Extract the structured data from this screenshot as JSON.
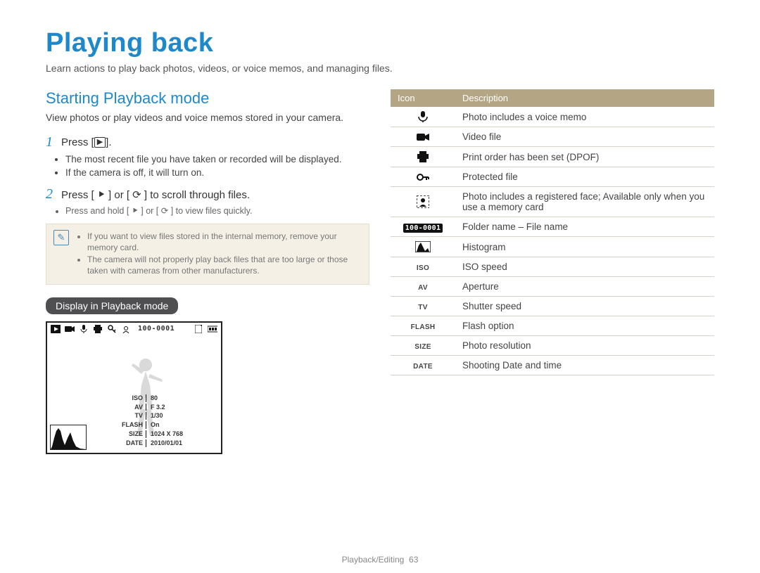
{
  "title": "Playing back",
  "subtitle": "Learn actions to play back photos, videos, or voice memos, and managing files.",
  "left": {
    "section_title": "Starting Playback mode",
    "section_desc": "View photos or play videos and voice memos stored in your camera.",
    "step1_num": "1",
    "step1_text_a": "Press [",
    "step1_text_b": "].",
    "step1_bullets": [
      "The most recent file you have taken or recorded will be displayed.",
      "If the camera is off, it will turn on."
    ],
    "step2_num": "2",
    "step2_text": "Press [ ⯈ ] or [ ⟳ ] to scroll through files.",
    "step2_bullets": [
      "Press and hold [ ⯈ ] or [ ⟳ ] to view files quickly."
    ],
    "note": [
      "If you want to view files stored in the internal memory, remove your memory card.",
      "The camera will not properly play back files that are too large or those taken with cameras from other manufacturers."
    ],
    "pill": "Display in Playback mode",
    "screen": {
      "folder_file": "100-0001",
      "info": {
        "ISO": "80",
        "AV": "F 3.2",
        "TV": "1/30",
        "FLASH": "On",
        "SIZE": "1024 X 768",
        "DATE": "2010/01/01"
      }
    }
  },
  "table": {
    "head_icon": "Icon",
    "head_desc": "Description",
    "rows": [
      {
        "icon_name": "mic-icon",
        "label": "",
        "desc": "Photo includes a voice memo"
      },
      {
        "icon_name": "video-icon",
        "label": "",
        "desc": "Video file"
      },
      {
        "icon_name": "printer-icon",
        "label": "",
        "desc": "Print order has been set (DPOF)"
      },
      {
        "icon_name": "key-icon",
        "label": "",
        "desc": "Protected file"
      },
      {
        "icon_name": "face-icon",
        "label": "",
        "desc": "Photo includes a registered face; Available only when you use a memory card"
      },
      {
        "icon_name": "folder-file",
        "label": "100-0001",
        "desc": "Folder name – File name"
      },
      {
        "icon_name": "histogram-icon",
        "label": "",
        "desc": "Histogram"
      },
      {
        "icon_name": "iso-label",
        "label": "ISO",
        "desc": "ISO speed"
      },
      {
        "icon_name": "av-label",
        "label": "AV",
        "desc": "Aperture"
      },
      {
        "icon_name": "tv-label",
        "label": "TV",
        "desc": "Shutter speed"
      },
      {
        "icon_name": "flash-label",
        "label": "FLASH",
        "desc": "Flash option"
      },
      {
        "icon_name": "size-label",
        "label": "SIZE",
        "desc": "Photo resolution"
      },
      {
        "icon_name": "date-label",
        "label": "DATE",
        "desc": "Shooting Date and time"
      }
    ]
  },
  "footer": {
    "section": "Playback/Editing",
    "page": "63"
  }
}
